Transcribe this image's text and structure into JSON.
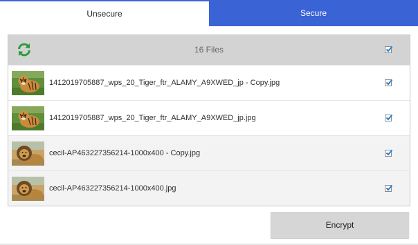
{
  "tabs": {
    "unsecure": "Unsecure",
    "secure": "Secure"
  },
  "file_list": {
    "count_label": "16 Files",
    "select_all_checked": true,
    "files": [
      {
        "name": "1412019705887_wps_20_Tiger_ftr_ALAMY_A9XWED_jp - Copy.jpg",
        "thumbnail": "tiger",
        "checked": true
      },
      {
        "name": "1412019705887_wps_20_Tiger_ftr_ALAMY_A9XWED_jp.jpg",
        "thumbnail": "tiger",
        "checked": true
      },
      {
        "name": "cecil-AP463227356214-1000x400 - Copy.jpg",
        "thumbnail": "lion",
        "checked": true
      },
      {
        "name": "cecil-AP463227356214-1000x400.jpg",
        "thumbnail": "lion",
        "checked": true
      }
    ]
  },
  "actions": {
    "encrypt_label": "Encrypt"
  },
  "colors": {
    "accent_blue": "#3a63d6",
    "refresh_green": "#2a9a3a",
    "header_gray": "#d3d3d3",
    "checkbox_blue": "#2b7fc4"
  },
  "icons": {
    "refresh": "refresh-icon",
    "checkbox": "checkbox-checked-icon"
  }
}
